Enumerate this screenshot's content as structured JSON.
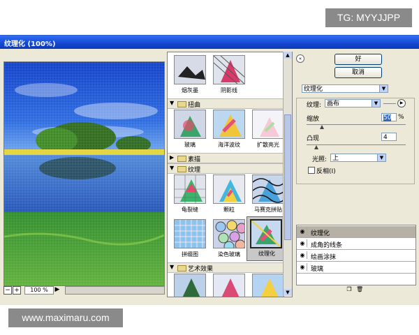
{
  "watermarks": {
    "top": "TG: MYYJJPP",
    "bottom": "www.maximaru.com"
  },
  "window": {
    "title": "纹理化 (100%)"
  },
  "preview": {
    "zoom": "100 %",
    "zoom_out": "−",
    "zoom_in": "+"
  },
  "gallery": {
    "top_row": [
      "烟灰墨",
      "阴影线"
    ],
    "categories": [
      {
        "label": "扭曲",
        "items": [
          "玻璃",
          "海洋波纹",
          "扩散亮光"
        ]
      },
      {
        "label": "素描",
        "items": []
      },
      {
        "label": "纹理",
        "items": [
          "龟裂缝",
          "颗粒",
          "马赛克拼贴",
          "拼缀图",
          "染色玻璃",
          "纹理化"
        ]
      },
      {
        "label": "艺术效果",
        "items": []
      }
    ],
    "selected": "纹理化"
  },
  "buttons": {
    "ok": "好",
    "cancel": "取消"
  },
  "filter_select": "纹理化",
  "settings": {
    "texture_label": "纹理:",
    "texture_value": "画布",
    "scaling_label": "缩放",
    "scaling_value": "50",
    "scaling_unit": "%",
    "relief_label": "凸现",
    "relief_value": "4",
    "light_label": "光照:",
    "light_value": "上",
    "invert_label": "反相(I)"
  },
  "layers": [
    "纹理化",
    "成角的线条",
    "绘画涂抹",
    "玻璃"
  ],
  "colors": {
    "titlebar": "#1547d1",
    "panel": "#ece9d8",
    "accent": "#316ac5"
  }
}
